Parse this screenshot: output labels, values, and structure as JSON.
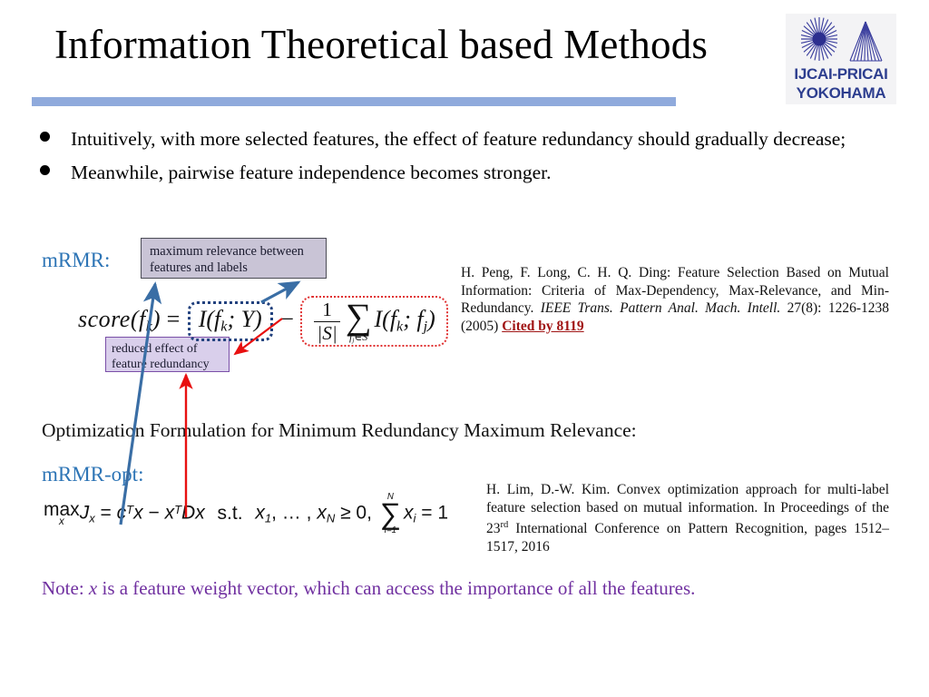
{
  "slide": {
    "title": "Information Theoretical based Methods",
    "accent_bar_color": "#8faadc"
  },
  "logo": {
    "line1": "IJCAI-PRICAI",
    "line2": "YOKOHAMA",
    "color": "#2d3e8f"
  },
  "bullets": [
    "Intuitively, with more selected features, the effect of feature redundancy should gradually decrease;",
    "Meanwhile, pairwise feature independence becomes stronger."
  ],
  "mrmr": {
    "label": "mRMR:",
    "label_color": "#2e75b6",
    "callout_relevance": "maximum relevance between features and labels",
    "callout_redundancy": "reduced effect of feature redundancy",
    "formula": {
      "lhs": "score(f",
      "lhs_sub": "k",
      "lhs_close": ")",
      "equals": "=",
      "relevance_term": "I(f",
      "relevance_sub": "k",
      "relevance_sep": "; Y)",
      "minus": "−",
      "frac_num": "1",
      "frac_den": "|S|",
      "sum_symbol": "∑",
      "sum_lower": "f",
      "sum_lower_sub": "j",
      "sum_lower_rest": "∈S",
      "redundancy_term": "I(f",
      "redundancy_sub1": "k",
      "redundancy_mid": "; f",
      "redundancy_sub2": "j",
      "redundancy_close": ")"
    }
  },
  "citation_peng": {
    "text": "H. Peng, F. Long, C. H. Q. Ding: Feature Selection Based on Mutual Information: Criteria of Max-Dependency, Max-Relevance, and Min-Redundancy. ",
    "journal": "IEEE Trans. Pattern Anal. Mach. Intell.",
    "details": " 27(8): 1226-1238 (2005)  ",
    "cited_by": "Cited by 8119",
    "cited_by_color": "#a01414"
  },
  "optimization": {
    "heading": "Optimization Formulation for Minimum Redundancy Maximum Relevance:",
    "label": "mRMR-opt:",
    "formula": {
      "max_top": "max",
      "max_bot": "x",
      "objective_j": "J",
      "objective_j_sub": "x",
      "equals": "=",
      "c_term": "c",
      "c_sup": "T",
      "c_var": "x",
      "minus": "−",
      "x_term": "x",
      "x_sup": "T",
      "d_term": "D",
      "d_var": "x",
      "st": "s.t.",
      "constraint_x1": "x",
      "constraint_x1_sub": "1",
      "constraint_dots": ", … , ",
      "constraint_xn": "x",
      "constraint_xn_sub": "N",
      "constraint_ge": " ≥ 0, ",
      "sum_symbol": "∑",
      "sum_upper": "N",
      "sum_lower": "i=1",
      "sum_body": "x",
      "sum_body_sub": "i",
      "sum_equals": " = 1"
    }
  },
  "citation_lim": {
    "text_a": "H. Lim, D.-W. Kim. Convex optimization approach for multi-label feature selection based on mutual information. In Proceedings of the 23",
    "sup": "rd",
    "text_b": " International Conference on Pattern Recognition, pages 1512–1517, 2016"
  },
  "note": {
    "prefix": "Note: ",
    "var": "x",
    "suffix": " is a feature weight vector, which can access the importance of all the features.",
    "color": "#7030a0"
  },
  "annotations": {
    "blue_arrow_color": "#3a6ea5",
    "red_arrow_color": "#e81010"
  }
}
